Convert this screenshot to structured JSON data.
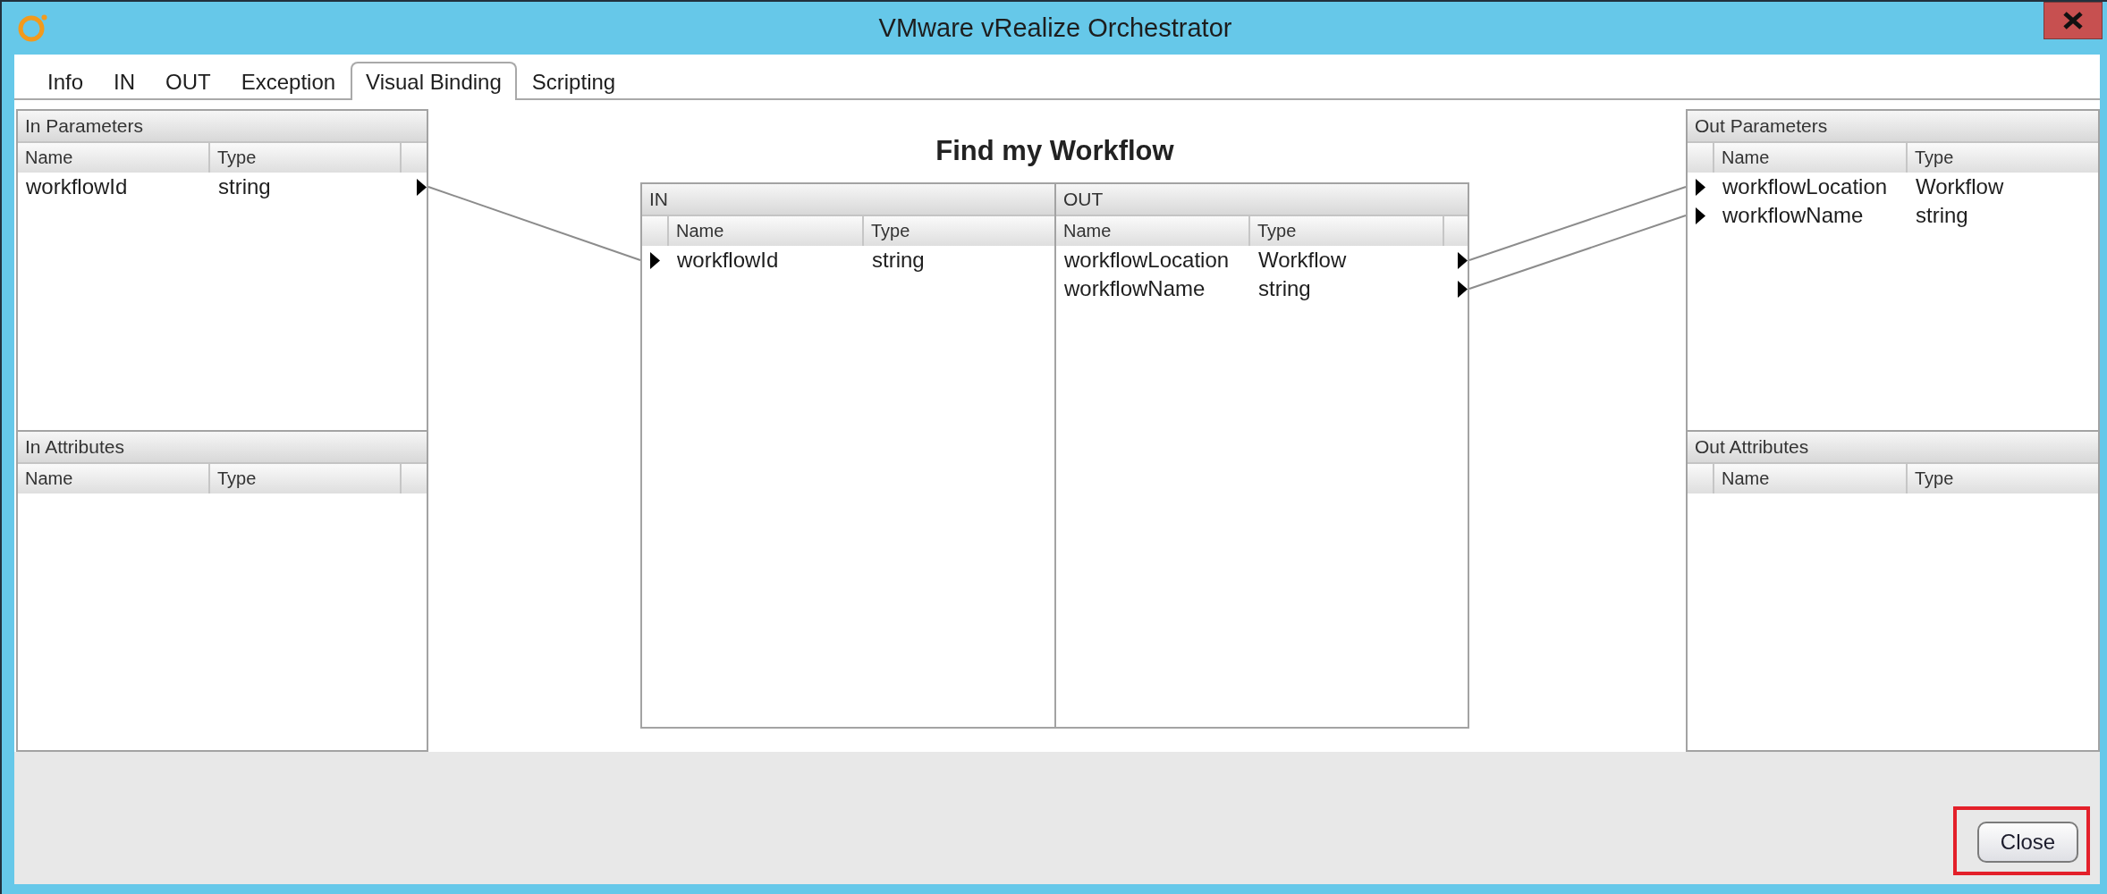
{
  "window": {
    "title": "VMware vRealize Orchestrator"
  },
  "tabs": [
    {
      "label": "Info",
      "selected": false
    },
    {
      "label": "IN",
      "selected": false
    },
    {
      "label": "OUT",
      "selected": false
    },
    {
      "label": "Exception",
      "selected": false
    },
    {
      "label": "Visual Binding",
      "selected": true
    },
    {
      "label": "Scripting",
      "selected": false
    }
  ],
  "in_parameters": {
    "title": "In Parameters",
    "columns": [
      "Name",
      "Type"
    ],
    "rows": [
      {
        "name": "workflowId",
        "type": "string",
        "bound": true
      }
    ]
  },
  "workflow": {
    "title": "Find my Workflow",
    "inputs": {
      "title": "IN",
      "columns": [
        "Name",
        "Type"
      ],
      "rows": [
        {
          "name": "workflowId",
          "type": "string",
          "bound": true
        }
      ]
    },
    "outputs": {
      "title": "OUT",
      "columns": [
        "Name",
        "Type"
      ],
      "rows": [
        {
          "name": "workflowLocation",
          "type": "Workflow",
          "bound": true
        },
        {
          "name": "workflowName",
          "type": "string",
          "bound": true
        }
      ]
    }
  },
  "out_parameters": {
    "title": "Out Parameters",
    "columns": [
      "Name",
      "Type"
    ],
    "rows": [
      {
        "name": "workflowLocation",
        "type": "Workflow",
        "bound": true
      },
      {
        "name": "workflowName",
        "type": "string",
        "bound": true
      }
    ]
  },
  "in_attributes": {
    "title": "In Attributes",
    "columns": [
      "Name",
      "Type"
    ]
  },
  "out_attributes": {
    "title": "Out Attributes",
    "columns": [
      "Name",
      "Type"
    ]
  },
  "buttons": [
    {
      "label": "Close",
      "highlighted": true
    }
  ]
}
